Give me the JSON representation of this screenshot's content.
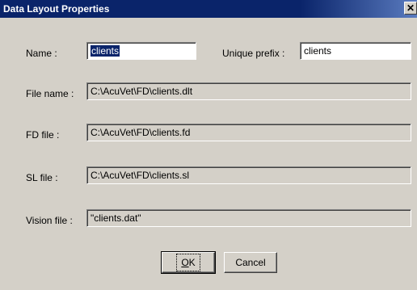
{
  "window": {
    "title": "Data Layout Properties",
    "close_glyph": "✕"
  },
  "fields": {
    "name": {
      "label": "Name :",
      "value": "clients"
    },
    "unique_prefix": {
      "label": "Unique prefix :",
      "value": "clients"
    },
    "file_name": {
      "label": "File name :",
      "value": "C:\\AcuVet\\FD\\clients.dlt"
    },
    "fd_file": {
      "label": "FD file :",
      "value": "C:\\AcuVet\\FD\\clients.fd"
    },
    "sl_file": {
      "label": "SL file :",
      "value": "C:\\AcuVet\\FD\\clients.sl"
    },
    "vision_file": {
      "label": "Vision file :",
      "value": "\"clients.dat\""
    }
  },
  "buttons": {
    "ok_mnemonic": "O",
    "ok_rest": "K",
    "cancel": "Cancel"
  },
  "colors": {
    "titlebar": "#0a246a",
    "dialog_face": "#d4d0c8",
    "selection": "#0a246a"
  }
}
